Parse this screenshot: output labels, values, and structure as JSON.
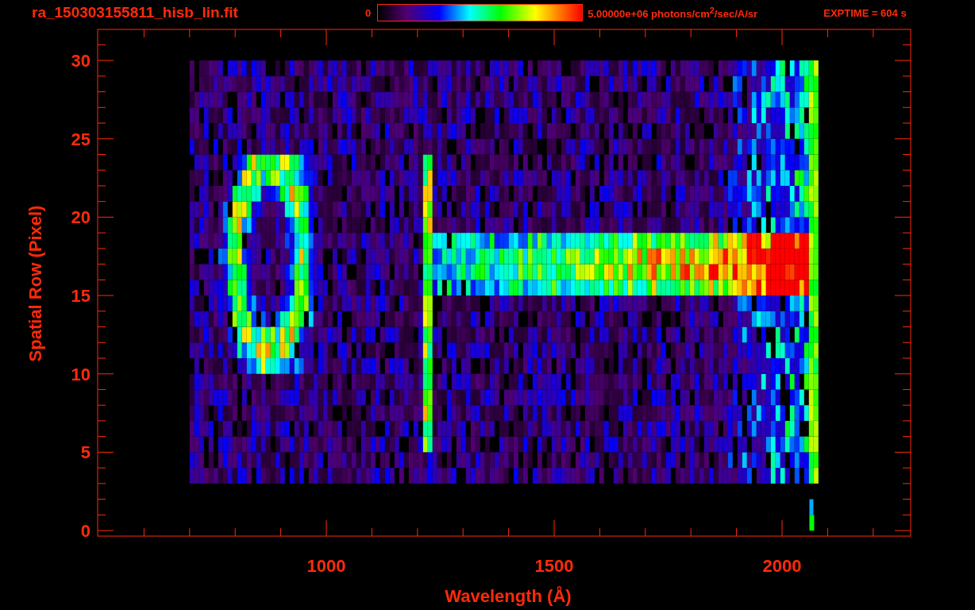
{
  "header": {
    "title": "ra_150303155811_hisb_lin.fit",
    "colorbar": {
      "min_label": "0",
      "max_label": "5.00000e+06 photons/cm$^{2}$/sec/A/sr"
    },
    "exposure": "EXPTIME = 604 s"
  },
  "plot": {
    "x_axis": {
      "label": "Wavelength (Å)",
      "ticks": [
        "1000",
        "1500",
        "2000"
      ]
    },
    "y_axis": {
      "label": "Spatial Row (Pixel)",
      "ticks": [
        "30",
        "25",
        "20",
        "15",
        "10",
        "5",
        "0"
      ]
    }
  }
}
